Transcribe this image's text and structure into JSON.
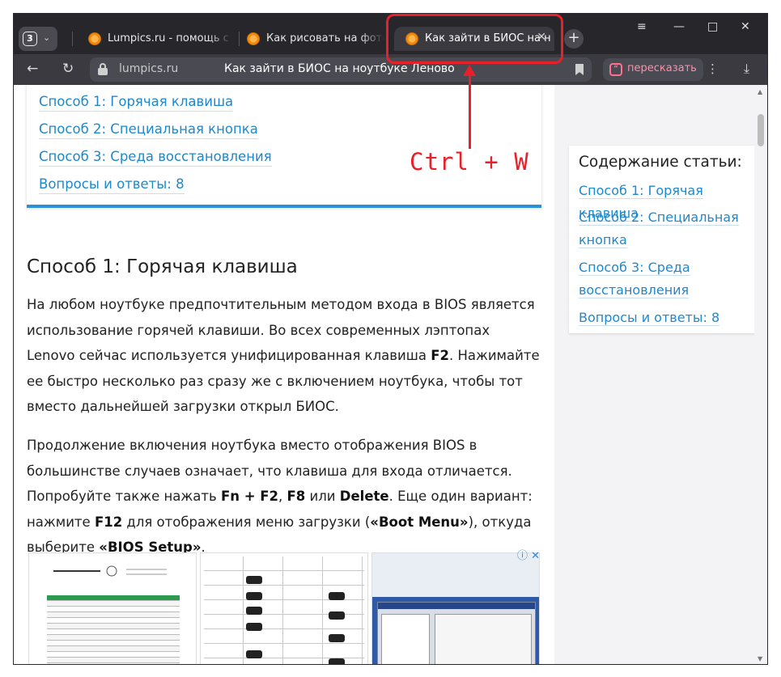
{
  "browser": {
    "tab_count": "3",
    "tabs": [
      {
        "title": "Lumpics.ru - помощь с ко"
      },
      {
        "title": "Как рисовать на фото в I"
      },
      {
        "title": "Как зайти в БИОС на н"
      }
    ],
    "address": {
      "domain": "lumpics.ru",
      "page_title": "Как зайти в БИОС на ноутбуке Леново"
    },
    "retell_label": "пересказать"
  },
  "annotation": {
    "shortcut": "Ctrl + W",
    "color": "#e8202a"
  },
  "toc": {
    "items": [
      "Способ 1: Горячая клавиша",
      "Способ 2: Специальная кнопка",
      "Способ 3: Среда восстановления",
      "Вопросы и ответы: 8"
    ]
  },
  "article": {
    "heading": "Способ 1: Горячая клавиша",
    "p1": {
      "t1": "На любом ноутбуке предпочтительным методом входа в BIOS является использование горячей клавиши. Во всех современных лэптопах Lenovo сейчас используется унифицированная клавиша ",
      "b1": "F2",
      "t2": ". Нажимайте ее быстро несколько раз сразу же с включением ноутбука, чтобы тот вместо дальнейшей загрузки открыл БИОС."
    },
    "p2": {
      "t1": "Продолжение включения ноутбука вместо отображения BIOS в большинстве случаев означает, что клавиша для входа отличается. Попробуйте также нажать ",
      "b1": "Fn + F2",
      "t2": ", ",
      "b2": "F8",
      "t3": " или ",
      "b3": "Delete",
      "t4": ". Еще один вариант: нажмите ",
      "b4": "F12",
      "t5": " для отображения меню загрузки (",
      "b5": "«Boot Menu»",
      "t6": "), откуда выберите ",
      "b6": "«BIOS Setup»",
      "t7": "."
    }
  },
  "sidebar": {
    "title": "Содержание статьи:",
    "items": [
      "Способ 1: Горячая клавиша",
      "Способ 2: Специальная кнопка",
      "Способ 3: Среда восстановления",
      "Вопросы и ответы: 8"
    ]
  },
  "colors": {
    "link": "#1f88cc",
    "toc_accent": "#2d8fd5",
    "tabbar": "#26262b"
  }
}
